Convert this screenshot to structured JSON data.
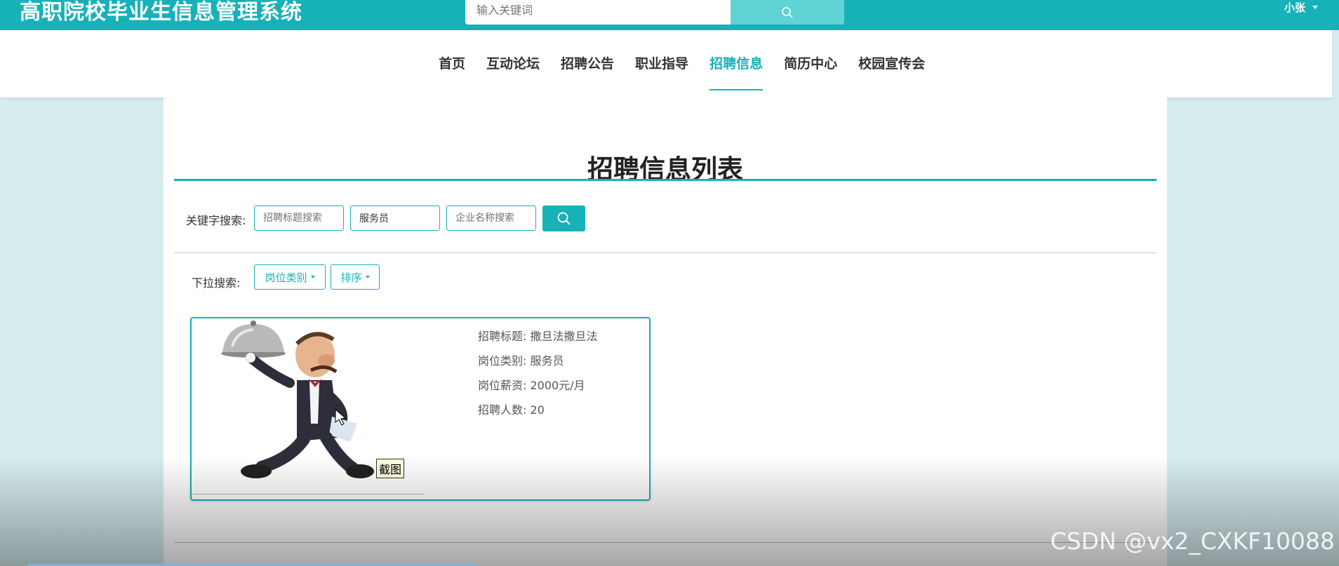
{
  "header": {
    "brand": "高职院校毕业生信息管理系统",
    "search_placeholder": "输入关键词",
    "user_name": "小张"
  },
  "nav": {
    "items": [
      {
        "label": "首页"
      },
      {
        "label": "互动论坛"
      },
      {
        "label": "招聘公告"
      },
      {
        "label": "职业指导"
      },
      {
        "label": "招聘信息",
        "active": true
      },
      {
        "label": "简历中心"
      },
      {
        "label": "校园宣传会"
      }
    ]
  },
  "main": {
    "title": "招聘信息列表",
    "keyword_label": "关键字搜索:",
    "search_title_placeholder": "招聘标题搜索",
    "search_category_value": "服务员",
    "search_company_placeholder": "企业名称搜索",
    "dropdown_label": "下拉搜索:",
    "dropdown_category": "岗位类别",
    "dropdown_sort": "排序"
  },
  "card": {
    "title_label": "招聘标题:",
    "title_value": "撒旦法撒旦法",
    "category_label": "岗位类别:",
    "category_value": "服务员",
    "salary_label": "岗位薪资:",
    "salary_value": "2000元/月",
    "count_label": "招聘人数:",
    "count_value": "20",
    "snapshot_tag": "截图"
  },
  "watermark": "CSDN @vx2_CXKF10088",
  "colors": {
    "accent": "#17b1b8",
    "background": "#d6ecee"
  }
}
